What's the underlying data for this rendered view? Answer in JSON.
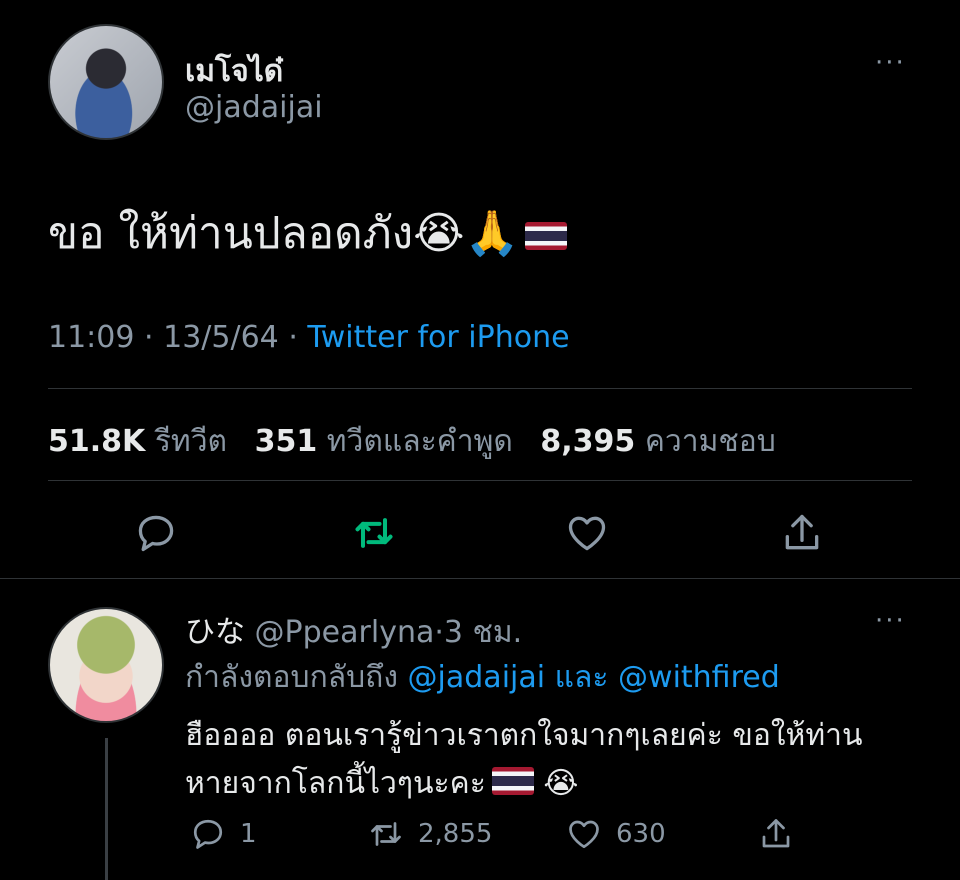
{
  "tweet": {
    "display_name": "เมโจได๋",
    "handle": "@jadaijai",
    "text": "ขอ ให้ท่านปลอดภัง",
    "emoji_cry": "😭",
    "emoji_pray": "🙏",
    "time": "11:09",
    "date": "13/5/64",
    "separator": "·",
    "source": "Twitter for iPhone",
    "stats": {
      "retweets_num": "51.8K",
      "retweets_label": "รีทวีต",
      "quotes_num": "351",
      "quotes_label": "ทวีตและคำพูด",
      "likes_num": "8,395",
      "likes_label": "ความชอบ"
    },
    "more": "···"
  },
  "reply": {
    "name": "ひな",
    "handle": "@Ppearlyna",
    "time": "3 ชม.",
    "replying_prefix": "กำลังตอบกลับถึง",
    "mention1": "@jadaijai",
    "and": "และ",
    "mention2": "@withfired",
    "text_line1": "ฮืออออ ตอนเรารู้ข่าวเราตกใจมากๆเลยค่ะ ขอให้ท่าน",
    "text_line2": "หายจากโลกนี้ไวๆนะคะ",
    "emoji_cry": "😭",
    "replies": "1",
    "retweets": "2,855",
    "likes": "630",
    "more": "···"
  },
  "colors": {
    "background": "#000000",
    "text": "#e7e9ea",
    "muted": "#8b98a5",
    "accent": "#1d9bf0",
    "retweet_active": "#00ba7c",
    "divider": "#2f3336"
  },
  "icons": [
    "reply-icon",
    "retweet-icon",
    "like-icon",
    "share-icon",
    "more-icon"
  ]
}
